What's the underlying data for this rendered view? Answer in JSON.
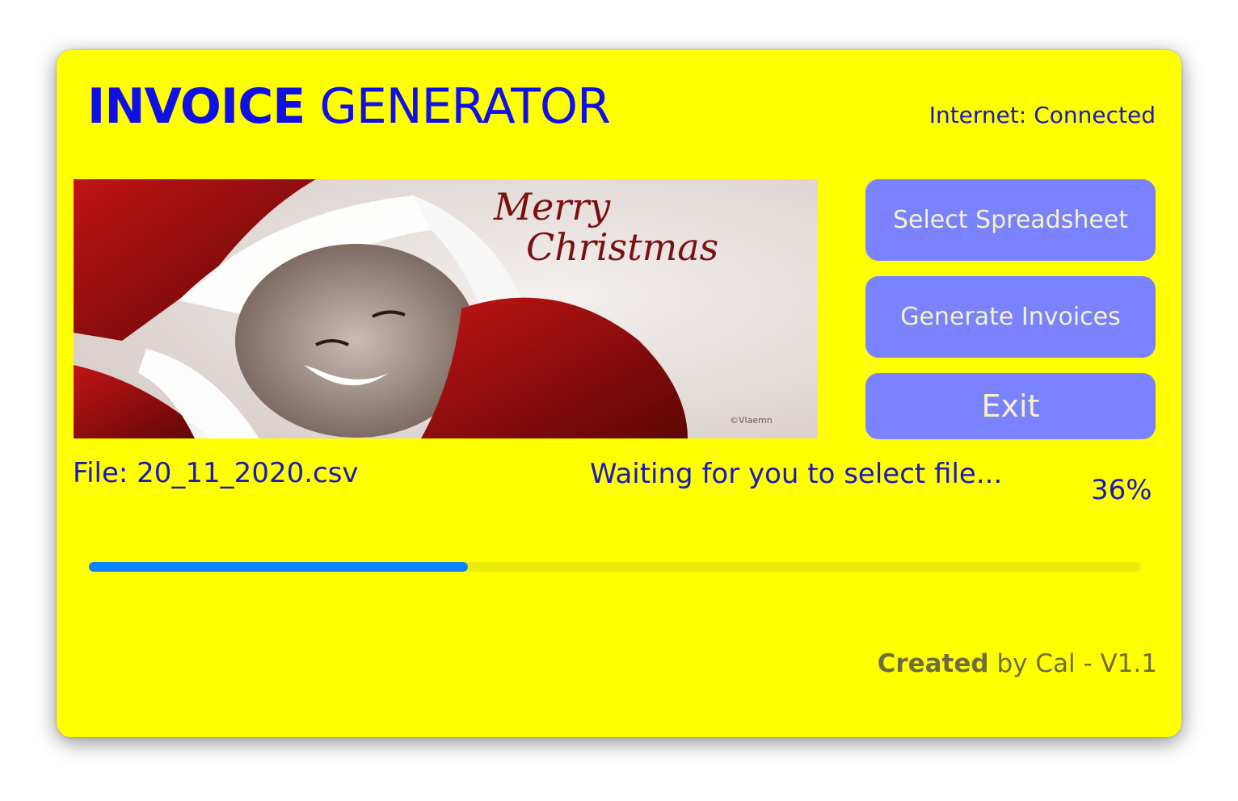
{
  "header": {
    "title_bold": "INVOICE",
    "title_rest": " GENERATOR",
    "internet_status": "Internet: Connected"
  },
  "banner": {
    "text_line1": "Merry",
    "text_line2": "Christmas",
    "signature": "©Vlaemn"
  },
  "buttons": {
    "select": "Select Spreadsheet",
    "generate": "Generate Invoices",
    "exit": "Exit"
  },
  "status": {
    "file": "File: 20_11_2020.csv",
    "message": "Waiting for you to select file...",
    "percent_label": "36%",
    "progress": 0.36
  },
  "footer": {
    "created_bold": "Created",
    "created_rest": " by Cal - V1.1"
  },
  "colors": {
    "background": "#ffff00",
    "title": "#1010e6",
    "button": "#7b82ff",
    "button_text": "#f4f3c8",
    "progress_fill": "#0a84ff"
  }
}
